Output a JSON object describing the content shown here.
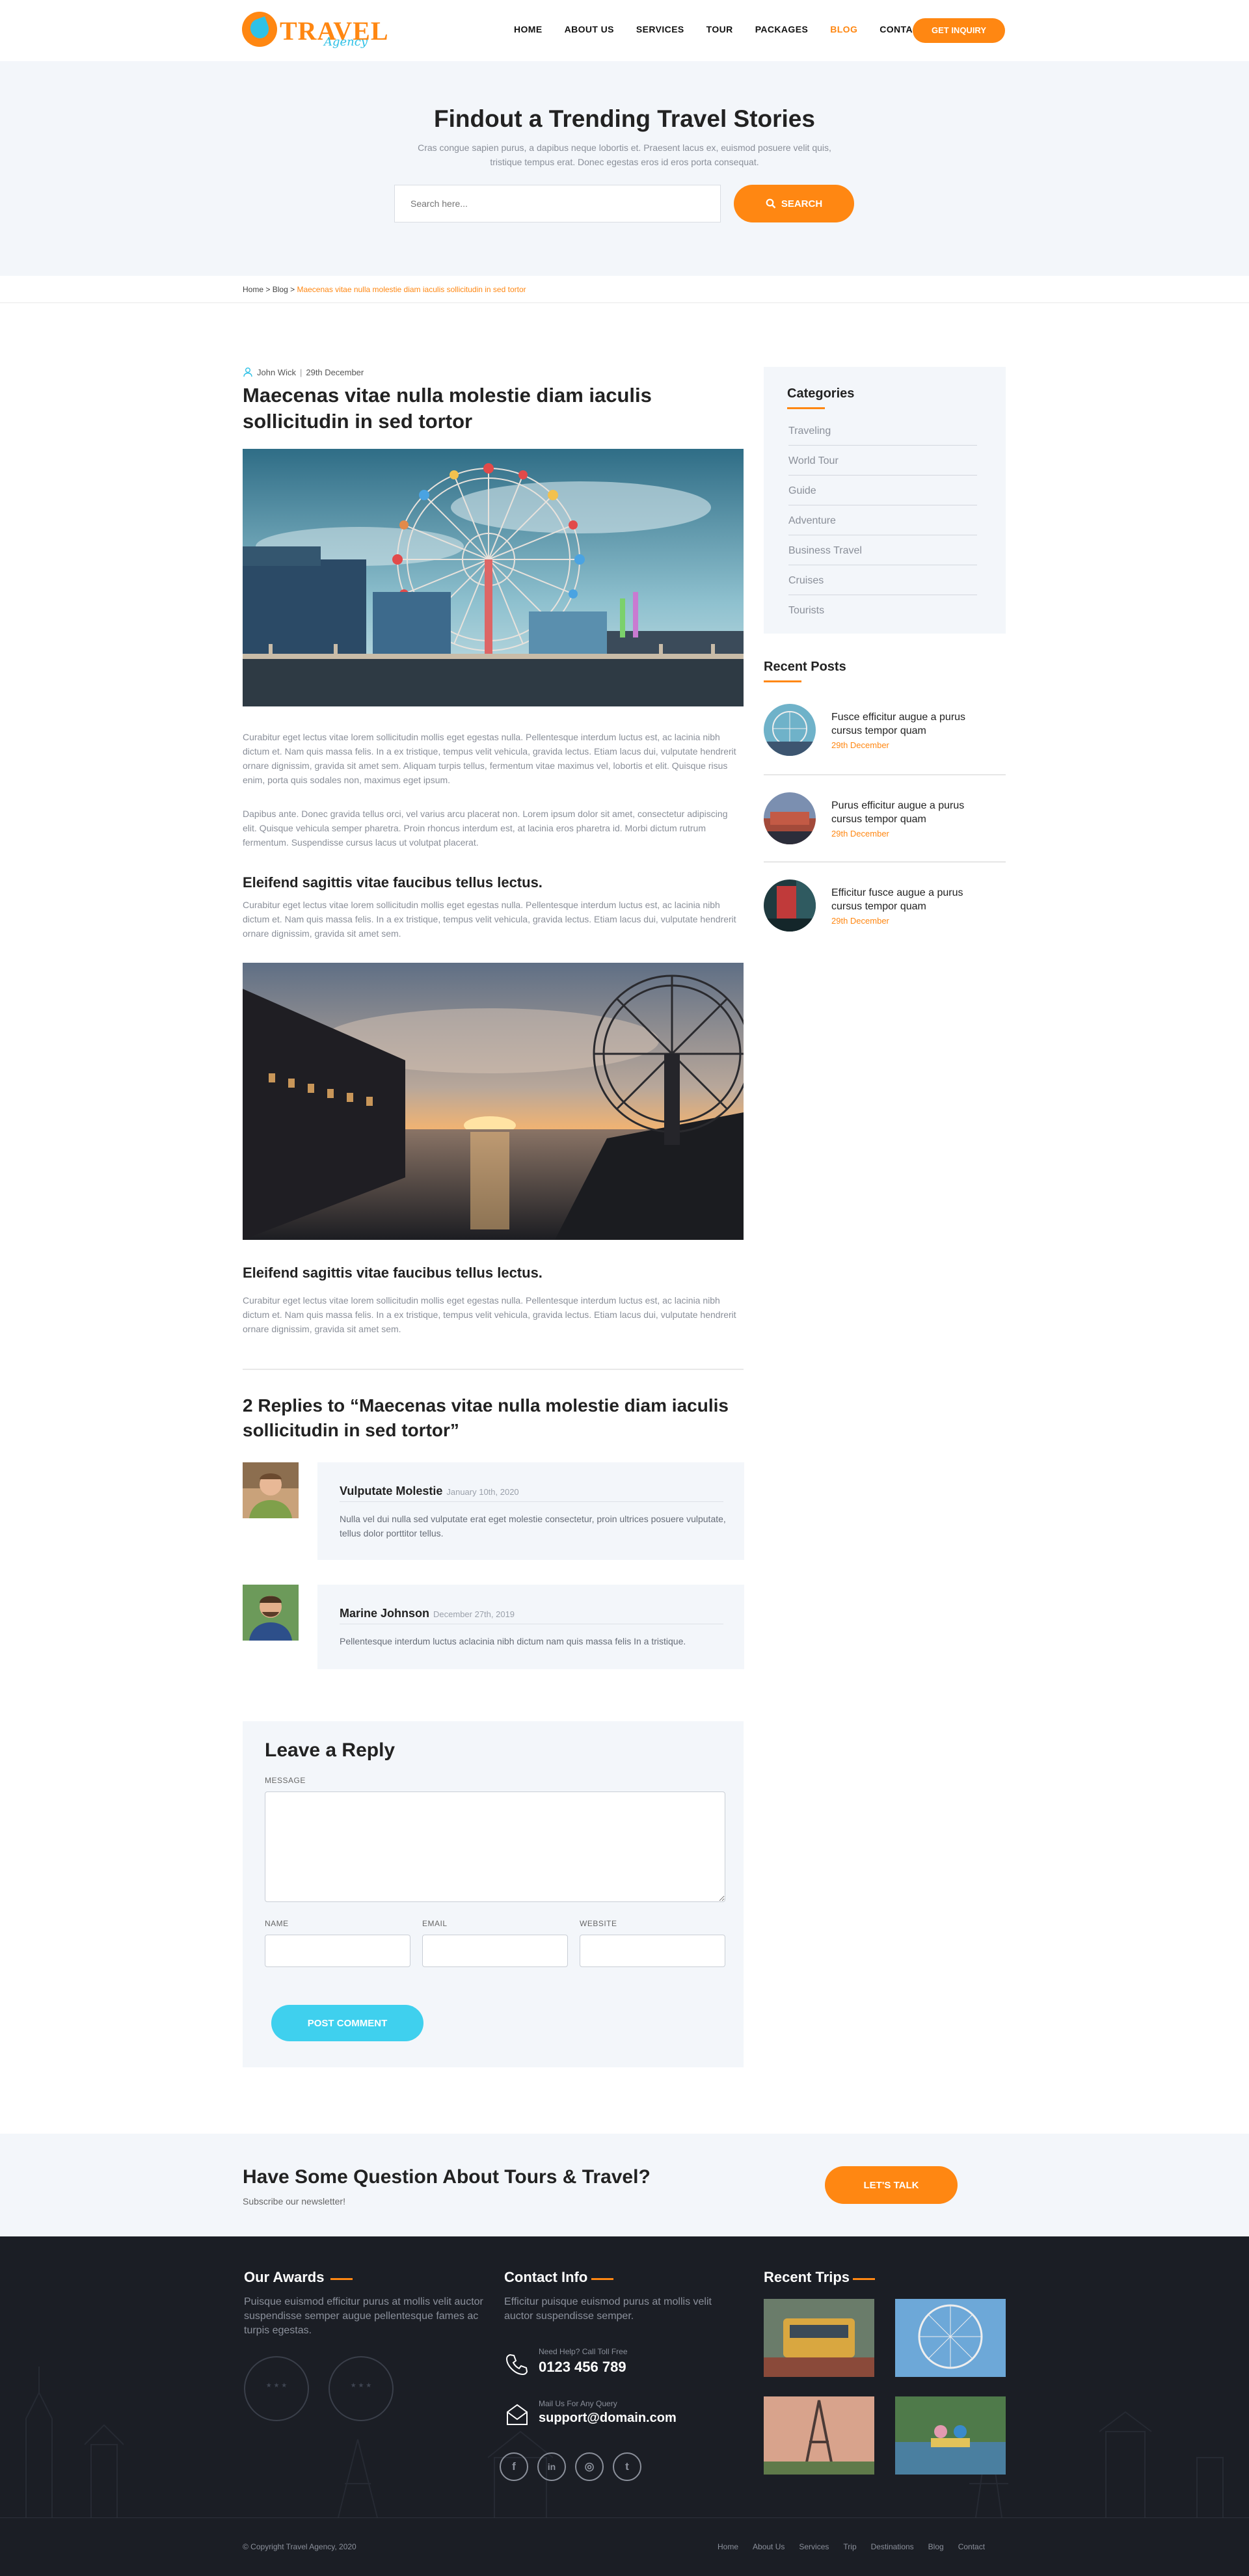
{
  "header": {
    "logo_text": "TRAVEL",
    "logo_sub": "Agency",
    "nav": [
      "HOME",
      "ABOUT US",
      "SERVICES",
      "TOUR",
      "PACKAGES",
      "BLOG",
      "CONTACT"
    ],
    "active_nav": "BLOG",
    "inquiry_label": "GET INQUIRY"
  },
  "hero": {
    "title": "Findout a Trending Travel Stories",
    "text": "Cras congue sapien purus, a dapibus neque lobortis et. Praesent lacus ex, euismod posuere velit quis, tristique tempus erat. Donec egestas eros id eros porta consequat.",
    "search_placeholder": "Search here...",
    "search_label": "SEARCH"
  },
  "breadcrumb": {
    "home": "Home",
    "sep": ">",
    "blog": "Blog",
    "current": "Maecenas vitae nulla molestie diam iaculis sollicitudin in sed tortor"
  },
  "article": {
    "author": "John Wick",
    "date": "29th December",
    "title": "Maecenas vitae nulla molestie diam iaculis sollicitudin in sed tortor",
    "para1": "Curabitur eget lectus vitae lorem sollicitudin mollis eget egestas nulla. Pellentesque interdum luctus est, ac lacinia nibh dictum et. Nam quis massa felis. In a ex tristique, tempus velit vehicula, gravida lectus. Etiam lacus dui, vulputate hendrerit ornare dignissim, gravida sit amet sem. Aliquam turpis tellus, fermentum vitae maximus vel, lobortis et elit. Quisque risus enim, porta quis sodales non, maximus eget ipsum.",
    "para2": "Dapibus ante. Donec gravida tellus orci, vel varius arcu placerat non. Lorem ipsum dolor sit amet, consectetur adipiscing elit. Quisque vehicula semper pharetra. Proin rhoncus interdum est, at lacinia eros pharetra id. Morbi dictum rutrum fermentum. Suspendisse cursus lacus ut volutpat placerat.",
    "sub1": "Eleifend sagittis vitae faucibus tellus lectus.",
    "para3": "Curabitur eget lectus vitae lorem sollicitudin mollis eget egestas nulla. Pellentesque interdum luctus est, ac lacinia nibh dictum et. Nam quis massa felis. In a ex tristique, tempus velit vehicula, gravida lectus. Etiam lacus dui, vulputate hendrerit ornare dignissim, gravida sit amet sem.",
    "sub2": "Eleifend sagittis vitae faucibus tellus lectus.",
    "para4": "Curabitur eget lectus vitae lorem sollicitudin mollis eget egestas nulla. Pellentesque interdum luctus est, ac lacinia nibh dictum et. Nam quis massa felis. In a ex tristique, tempus velit vehicula, gravida lectus. Etiam lacus dui, vulputate hendrerit ornare dignissim, gravida sit amet sem."
  },
  "replies": {
    "title": "2 Replies to “Maecenas vitae nulla molestie diam iaculis sollicitudin in sed tortor”",
    "items": [
      {
        "name": "Vulputate Molestie",
        "date": "January 10th, 2020",
        "text": "Nulla vel dui nulla sed vulputate erat eget molestie consectetur, proin ultrices posuere vulputate, tellus dolor porttitor tellus."
      },
      {
        "name": "Marine Johnson",
        "date": "December 27th, 2019",
        "text": "Pellentesque interdum luctus aclacinia nibh dictum nam quis massa felis In a tristique."
      }
    ]
  },
  "reply_form": {
    "title": "Leave a Reply",
    "message_label": "MESSAGE",
    "name_label": "NAME",
    "email_label": "EMAIL",
    "website_label": "WEBSITE",
    "submit_label": "POST COMMENT"
  },
  "sidebar": {
    "categories_title": "Categories",
    "categories": [
      "Traveling",
      "World Tour",
      "Guide",
      "Adventure",
      "Business Travel",
      "Cruises",
      "Tourists"
    ],
    "recent_title": "Recent Posts",
    "recent": [
      {
        "title": "Fusce efficitur augue a purus cursus tempor quam",
        "date": "29th December"
      },
      {
        "title": "Purus efficitur augue a purus cursus tempor quam",
        "date": "29th December"
      },
      {
        "title": "Efficitur fusce augue a purus cursus tempor quam",
        "date": "29th December"
      }
    ]
  },
  "question": {
    "title": "Have Some Question About Tours & Travel?",
    "sub": "Subscribe our newsletter!",
    "button": "LET'S TALK"
  },
  "footer": {
    "awards_title": "Our Awards",
    "awards_text": "Puisque euismod efficitur purus at mollis velit auctor suspendisse semper augue pellentesque fames ac turpis egestas.",
    "contact_title": "Contact Info",
    "contact_text": "Efficitur puisque euismod purus at mollis velit auctor suspendisse semper.",
    "phone_label": "Need Help? Call Toll Free",
    "phone": "0123 456 789",
    "mail_label": "Mail Us For Any Query",
    "email": "support@domain.com",
    "trips_title": "Recent Trips",
    "copyright": "© Copyright Travel Agency, 2020",
    "links": [
      "Home",
      "About Us",
      "Services",
      "Trip",
      "Destinations",
      "Blog",
      "Contact"
    ]
  },
  "colors": {
    "accent": "#ff8712",
    "secondary": "#3fd0ee",
    "footer_bg": "#1b1e25",
    "light_bg": "#f3f6fa"
  }
}
